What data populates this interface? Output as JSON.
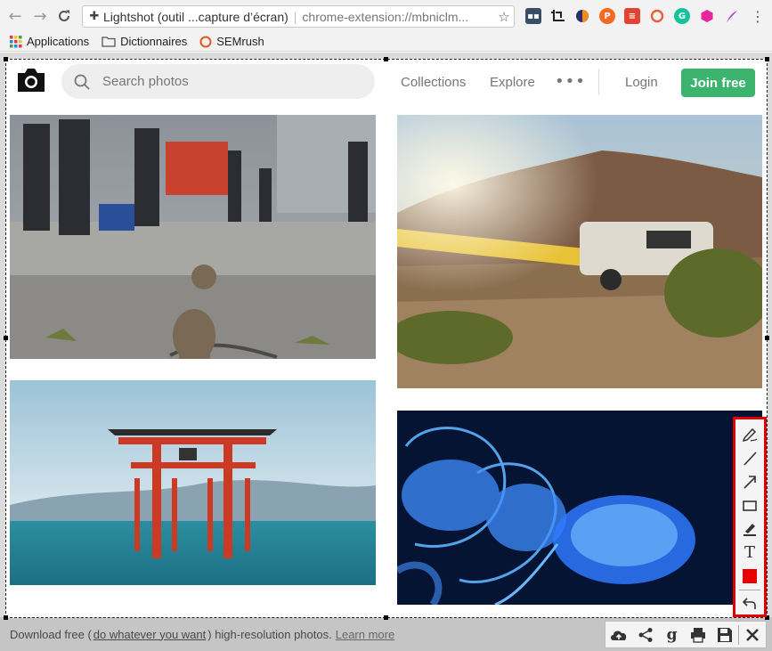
{
  "browser": {
    "tab_title": "Lightshot (outil ...capture d’écran)",
    "url": "chrome-extension://mbniclm...",
    "bookmarks": [
      {
        "label": "Applications"
      },
      {
        "label": "Dictionnaires"
      },
      {
        "label": "SEMrush"
      }
    ],
    "extensions": [
      "keyboard-icon",
      "screenshot-icon",
      "pocket-like-icon",
      "p-icon",
      "todoist-icon",
      "circle-icon",
      "grammarly-icon",
      "hexagon-icon",
      "feather-icon"
    ],
    "menu_label": "⋮"
  },
  "site": {
    "search_placeholder": "Search photos",
    "nav": {
      "collections": "Collections",
      "explore": "Explore",
      "more": "•••",
      "login": "Login",
      "join": "Join free"
    },
    "footer": {
      "prefix": "Download free (",
      "link": "do whatever you want",
      "middle": ") high-resolution photos.",
      "learn_more": "Learn more"
    },
    "brand_color": "#3cb46e"
  },
  "lightshot": {
    "tools_vertical": [
      "pencil-icon",
      "line-icon",
      "arrow-icon",
      "rectangle-icon",
      "marker-icon",
      "text-icon",
      "color-picker-icon",
      "undo-icon"
    ],
    "tools_horizontal": [
      "upload-icon",
      "share-icon",
      "google-search-icon",
      "print-icon",
      "save-icon",
      "close-icon"
    ],
    "text_tool_glyph": "T",
    "google_glyph": "g",
    "selected_color": "#e60000"
  }
}
